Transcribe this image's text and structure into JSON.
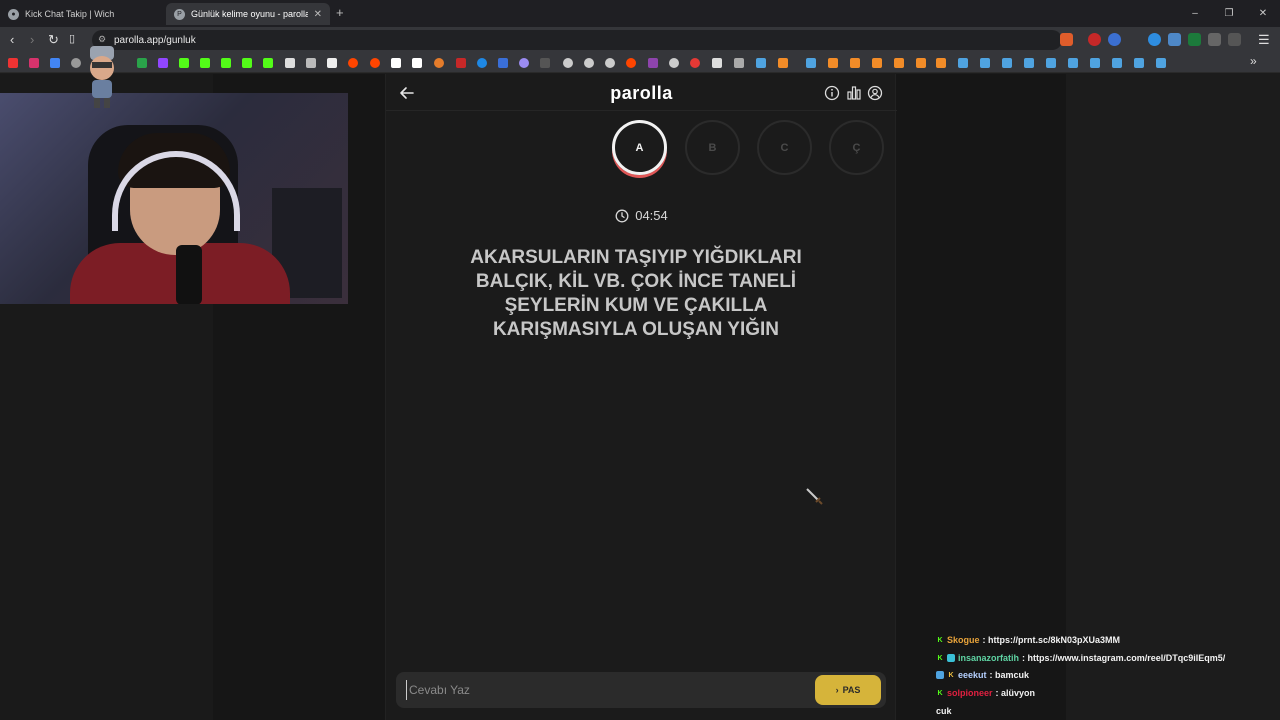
{
  "browser": {
    "tabs": [
      {
        "title": "Kick Chat Takip | Wich",
        "active": false
      },
      {
        "title": "Günlük kelime oyunu - parolla -",
        "active": true
      }
    ],
    "new_tab": "+",
    "window_controls": [
      "–",
      "❐",
      "✕"
    ],
    "url": "parolla.app/gunluk"
  },
  "app": {
    "logo": "parolla",
    "letters": [
      {
        "label": "A",
        "active": true
      },
      {
        "label": "B",
        "active": false
      },
      {
        "label": "C",
        "active": false
      },
      {
        "label": "Ç",
        "active": false
      }
    ],
    "timer": "04:54",
    "question": "AKARSULARIN TAŞIYIP YIĞDIKLARI BALÇIK, KİL VB. ÇOK İNCE TANELİ ŞEYLERİN KUM VE ÇAKILLA KARIŞMASIYLA OLUŞAN YIĞIN",
    "answer_placeholder": "Cevabı Yaz",
    "pas_label": "PAS",
    "accent_color": "#d6b43a",
    "active_ring_color": "#e05757"
  },
  "chat": {
    "messages": [
      {
        "user": "Skogue",
        "text": ": https://prnt.sc/8kN03pXUa3MM",
        "color": "#e8a33a"
      },
      {
        "user": "insanazorfatih",
        "text": ": https://www.instagram.com/reel/DTqc9iIEqm5/",
        "color": "#5fd3a3"
      },
      {
        "user": "eeekut",
        "text": ": bamcuk",
        "color": "#b5d0ff"
      },
      {
        "user": "solpioneer",
        "text": ": alüvyon",
        "color": "#e02040"
      },
      {
        "user": "",
        "text": "cuk",
        "color": "#ffffff"
      }
    ]
  }
}
